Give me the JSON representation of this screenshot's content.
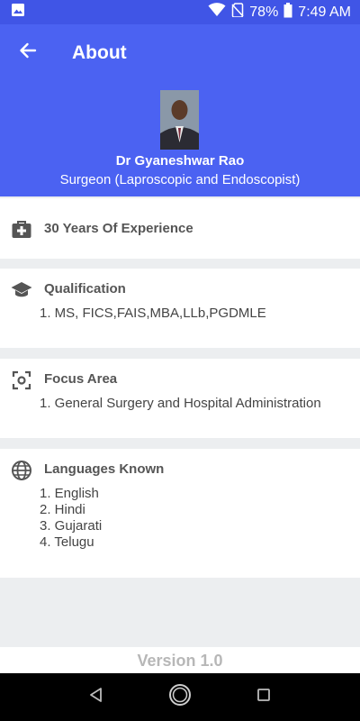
{
  "status_bar": {
    "battery": "78%",
    "time": "7:49 AM"
  },
  "app_bar": {
    "title": "About"
  },
  "profile": {
    "name": "Dr Gyaneshwar Rao",
    "title": "Surgeon (Laproscopic and Endoscopist)"
  },
  "experience": {
    "heading": "30 Years Of Experience"
  },
  "qualification": {
    "heading": "Qualification",
    "items": [
      "1. MS, FICS,FAIS,MBA,LLb,PGDMLE"
    ]
  },
  "focus": {
    "heading": "Focus Area",
    "items": [
      "1. General Surgery and Hospital Administration"
    ]
  },
  "languages": {
    "heading": "Languages Known",
    "items": [
      "1. English",
      "2. Hindi",
      "3. Gujarati",
      "4. Telugu"
    ]
  },
  "footer": {
    "version": "Version 1.0"
  },
  "colors": {
    "primary": "#4b62f2",
    "status_bar": "#4055e6",
    "background": "#eceef0",
    "icon": "#555555"
  }
}
